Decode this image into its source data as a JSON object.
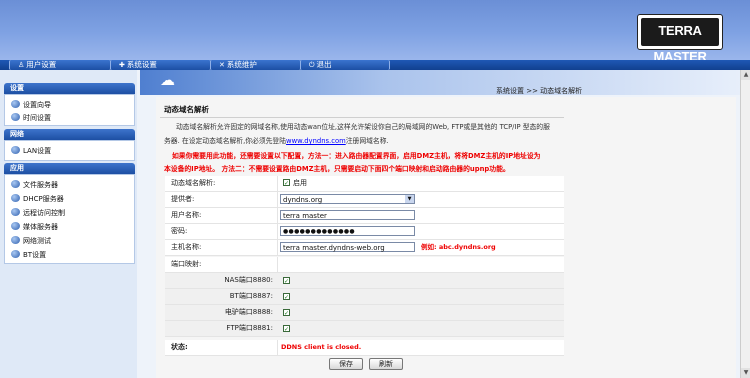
{
  "brand": "TERRA MASTER",
  "nav": {
    "tabs": [
      {
        "icon": "user-icon",
        "label": "用户设置"
      },
      {
        "icon": "wrench-icon",
        "label": "系统设置"
      },
      {
        "icon": "tools-icon",
        "label": "系统维护"
      },
      {
        "icon": "power-icon",
        "label": "退出"
      }
    ]
  },
  "sidebar": {
    "sections": [
      {
        "title": "设置",
        "items": [
          "设置向导",
          "时间设置"
        ]
      },
      {
        "title": "网络",
        "items": [
          "LAN设置"
        ]
      },
      {
        "title": "应用",
        "items": [
          "文件服务器",
          "DHCP服务器",
          "远程访问控制",
          "媒体服务器",
          "网络测试",
          "BT设置"
        ]
      }
    ]
  },
  "breadcrumb": "系统设置 >> 动态域名解析",
  "page": {
    "title": "动态域名解析",
    "desc_line1": "动态域名解析允许固定的网域名称,使用动态wan位址,这样允许架设你自己的局域网的Web, FTP或是其他的 TCP/IP 型态的服",
    "desc_line2_pre": "务器. 在设定动态域名解析,你必须先登陆",
    "desc_link": "www.dyndns.com",
    "desc_line2_post": "注册网域名称.",
    "warn_line1": "如果你需要用此功能，还需要设置以下配置，方法一：进入路由器配置界面，启用DMZ主机，将将DMZ主机的IP地址设为",
    "warn_line2": "本设备的IP地址。 方法二：不需要设置路由DMZ主机，只需要启动下面四个端口映射和启动路由器的upnp功能。"
  },
  "form": {
    "ddns_label": "动态域名解析:",
    "ddns_enabled": true,
    "ddns_enable_text": "启用",
    "provider_label": "提供者:",
    "provider_value": "dyndns.org",
    "username_label": "用户名称:",
    "username_value": "terra master",
    "password_label": "密码:",
    "password_value": "●●●●●●●●●●●●●",
    "hostname_label": "主机名称:",
    "hostname_value": "terra master.dyndns-web.org",
    "hostname_example": "例如: abc.dyndns.org",
    "portmap_label": "端口映射:",
    "ports": [
      {
        "label": "NAS端口8880:",
        "checked": true
      },
      {
        "label": "BT端口8887:",
        "checked": true
      },
      {
        "label": "电驴端口8888:",
        "checked": true
      },
      {
        "label": "FTP端口8881:",
        "checked": true
      }
    ],
    "status_label": "状态:",
    "status_value": "DDNS client is closed.",
    "save_label": "保存",
    "refresh_label": "刷新"
  },
  "colors": {
    "accent": "#1f58b5",
    "warning": "#ee0000",
    "link": "#0000ff"
  }
}
